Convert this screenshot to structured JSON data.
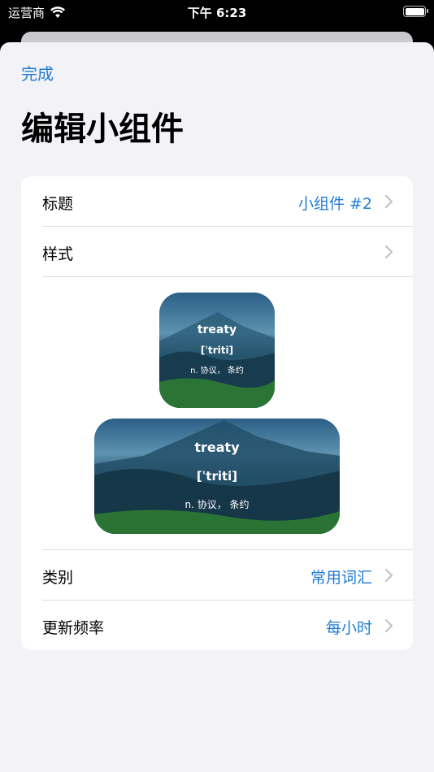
{
  "status_bar": {
    "carrier": "运营商",
    "time": "下午 6:23"
  },
  "nav": {
    "done_label": "完成",
    "title": "编辑小组件"
  },
  "settings": {
    "title_row": {
      "label": "标题",
      "value": "小组件 #2"
    },
    "style_row": {
      "label": "样式"
    },
    "category_row": {
      "label": "类别",
      "value": "常用词汇"
    },
    "frequency_row": {
      "label": "更新频率",
      "value": "每小时"
    }
  },
  "preview": {
    "word": "treaty",
    "phonetic": "[ˈtriti]",
    "meaning": "n. 协议， 条约"
  },
  "colors": {
    "accent": "#1f7bd6",
    "background": "#f2f2f7"
  }
}
